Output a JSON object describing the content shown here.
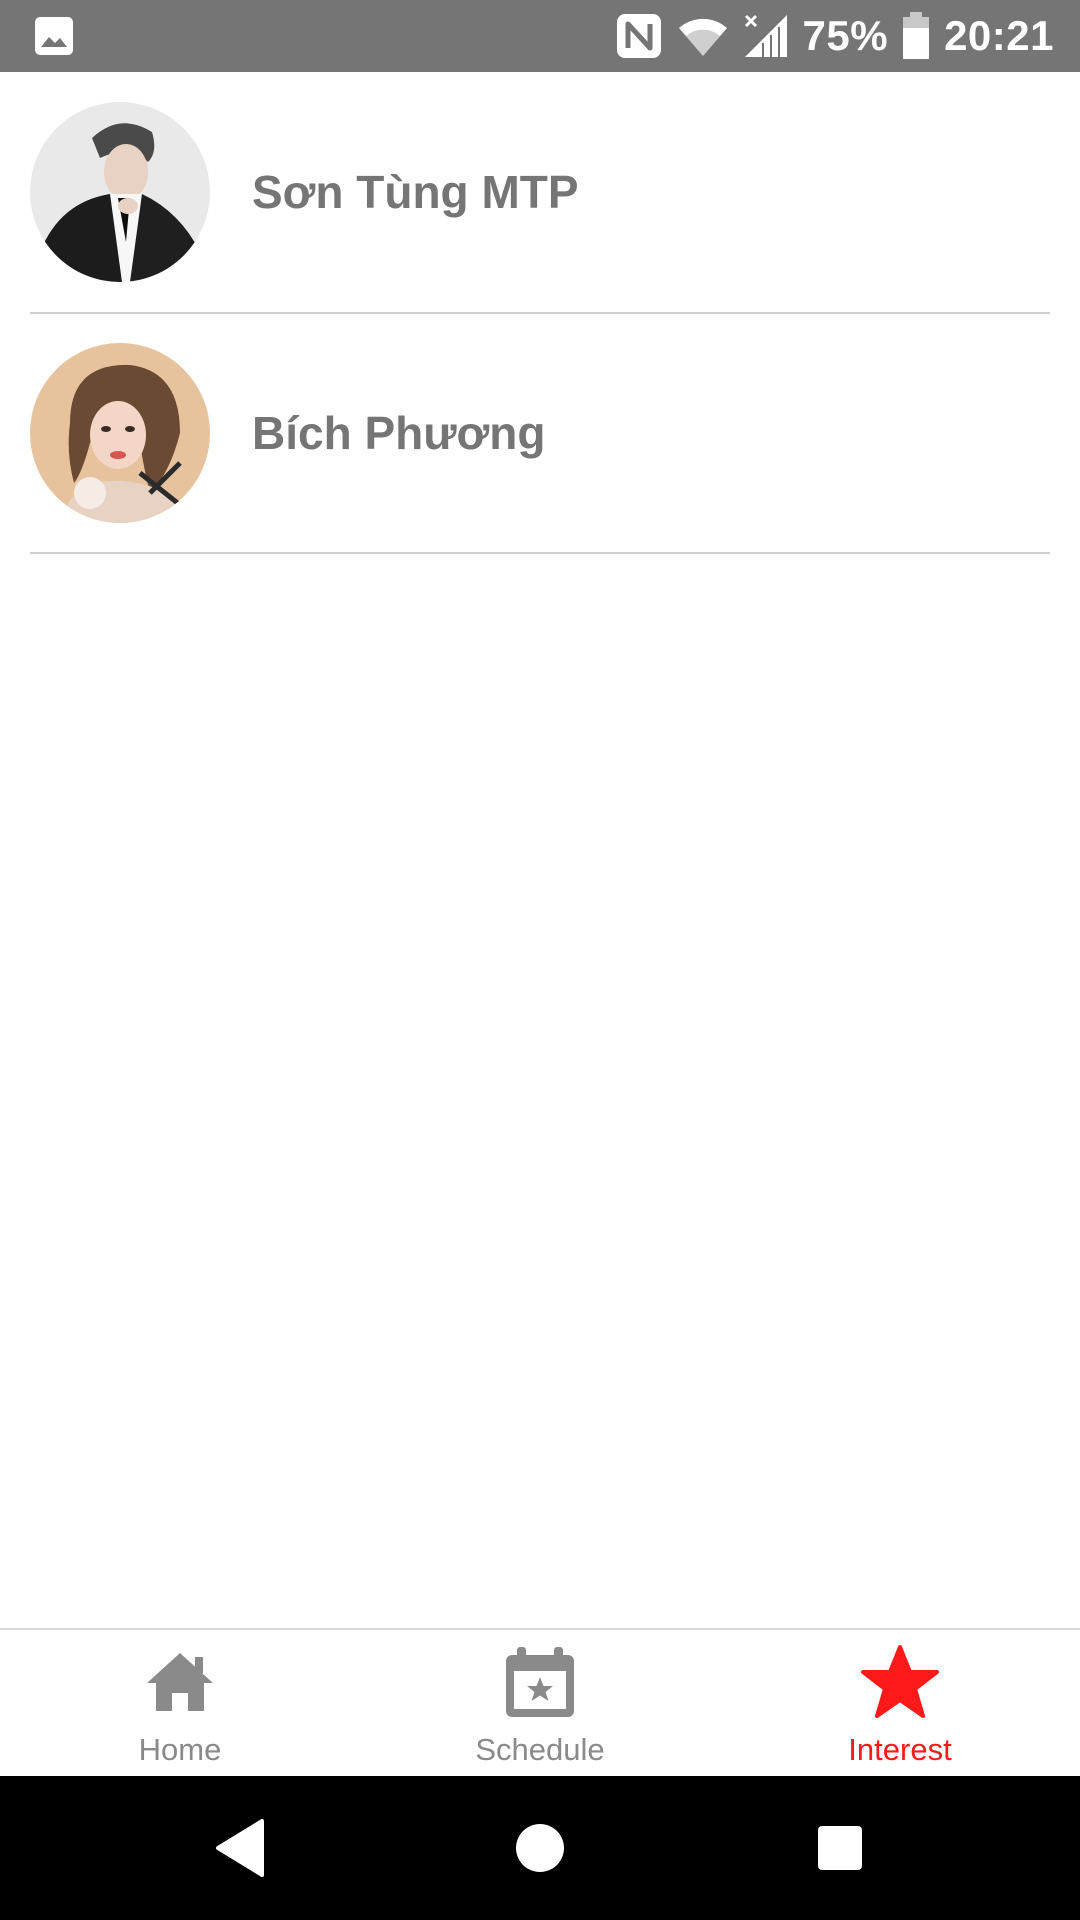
{
  "status_bar": {
    "battery_percent": "75%",
    "time": "20:21",
    "icons": [
      "image-notification-icon",
      "nfc-icon",
      "wifi-icon",
      "signal-icon",
      "battery-icon"
    ]
  },
  "interests": [
    {
      "name": "Sơn Tùng MTP",
      "avatar": "avatar-son-tung-mtp"
    },
    {
      "name": "Bích Phương",
      "avatar": "avatar-bich-phuong"
    }
  ],
  "tabs": [
    {
      "label": "Home",
      "icon": "home-icon",
      "active": false
    },
    {
      "label": "Schedule",
      "icon": "calendar-star-icon",
      "active": false
    },
    {
      "label": "Interest",
      "icon": "star-icon",
      "active": true
    }
  ],
  "colors": {
    "status_bar": "#757575",
    "active_tab": "#ff1a1a",
    "inactive_tab": "#8a8a8a",
    "name_text": "#757575",
    "nav_bar": "#000000"
  },
  "nav_bar": {
    "icons": [
      "back-icon",
      "home-circle-icon",
      "recents-icon"
    ]
  }
}
